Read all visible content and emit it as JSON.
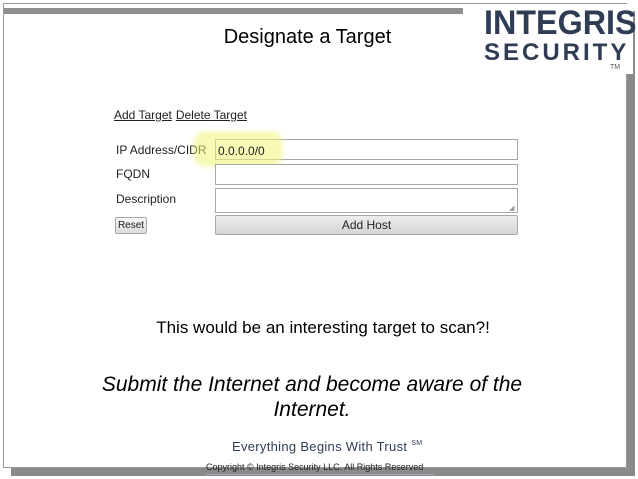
{
  "slide": {
    "title": "Designate a Target",
    "caption": "This would be an interesting target to scan?!",
    "note": "Submit the Internet and become aware of the Internet."
  },
  "logo": {
    "line1": "INTEGRIS",
    "line2": "SECURITY",
    "tm": "TM",
    "color": "#2f3c53"
  },
  "form": {
    "links": {
      "add_target": "Add Target",
      "delete_target": "Delete Target"
    },
    "fields": {
      "ip_label": "IP Address/CIDR",
      "ip_value": "0.0.0.0/0",
      "fqdn_label": "FQDN",
      "fqdn_value": "",
      "description_label": "Description",
      "description_value": ""
    },
    "buttons": {
      "reset": "Reset",
      "add_host": "Add Host"
    },
    "highlight_color": "#f0f578"
  },
  "footer": {
    "tagline": "Everything Begins With Trust",
    "service_mark": "SM",
    "copyright": "Copyright © Integris Security LLC. All Rights Reserved"
  }
}
